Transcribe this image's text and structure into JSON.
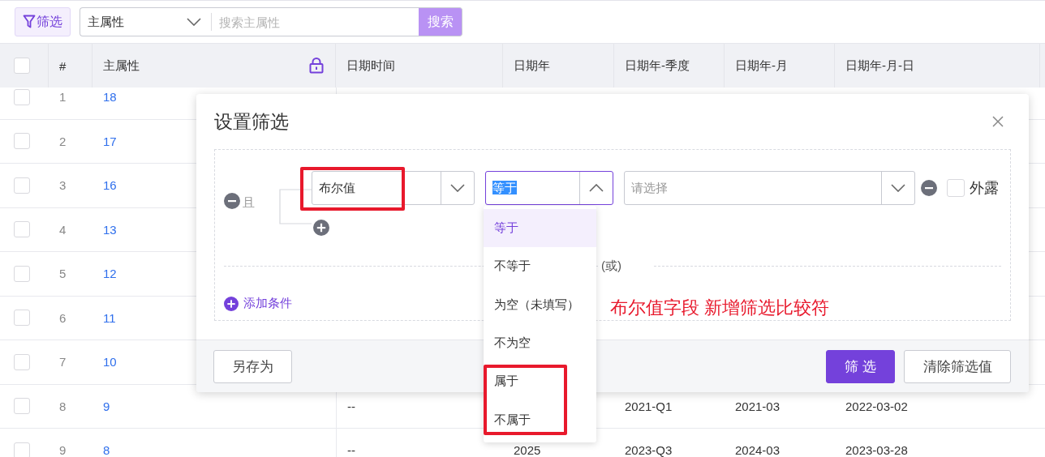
{
  "toolbar": {
    "filter_button": "筛选",
    "field_select": "主属性",
    "search": {
      "placeholder": "搜索主属性"
    },
    "search_button": "搜索"
  },
  "table": {
    "header_checked": false,
    "columns": [
      "#",
      "主属性",
      "日期时间",
      "日期年",
      "日期年-季度",
      "日期年-月",
      "日期年-月-日"
    ],
    "rows": [
      {
        "checked": false,
        "index": "1",
        "main": "18"
      },
      {
        "checked": false,
        "index": "2",
        "main": "17"
      },
      {
        "checked": false,
        "index": "3",
        "main": "16"
      },
      {
        "checked": false,
        "index": "4",
        "main": "13"
      },
      {
        "checked": false,
        "index": "5",
        "main": "12"
      },
      {
        "checked": false,
        "index": "6",
        "main": "11"
      },
      {
        "checked": false,
        "index": "7",
        "main": "10"
      },
      {
        "checked": false,
        "index": "8",
        "main": "9",
        "datetime": "--",
        "quarter": "2021-Q1",
        "month": "2021-03",
        "date": "2022-03-02"
      },
      {
        "checked": false,
        "index": "9",
        "main": "8",
        "datetime": "--",
        "year": "2025",
        "quarter": "2023-Q3",
        "month": "2024-03",
        "date": "2023-03-28"
      }
    ]
  },
  "dialog": {
    "title": "设置筛选",
    "condition": {
      "connector": "且",
      "field": "布尔值",
      "operator": {
        "value": "等于",
        "text_highlighted": true,
        "open": true
      },
      "value": {
        "placeholder": "请选择"
      },
      "exposed": {
        "label": "外露",
        "checked": false
      }
    },
    "or_label": "(或)",
    "add_condition": "添加条件",
    "operator_options": [
      {
        "label": "等于",
        "selected": true
      },
      {
        "label": "不等于",
        "selected": false
      },
      {
        "label": "为空（未填写）",
        "selected": false
      },
      {
        "label": "不为空",
        "selected": false
      },
      {
        "label": "属于",
        "selected": false
      },
      {
        "label": "不属于",
        "selected": false
      }
    ],
    "save_as_button": "另存为",
    "apply_button": "筛选",
    "clear_button": "清除筛选值"
  },
  "annotation": "布尔值字段 新增筛选比较符"
}
